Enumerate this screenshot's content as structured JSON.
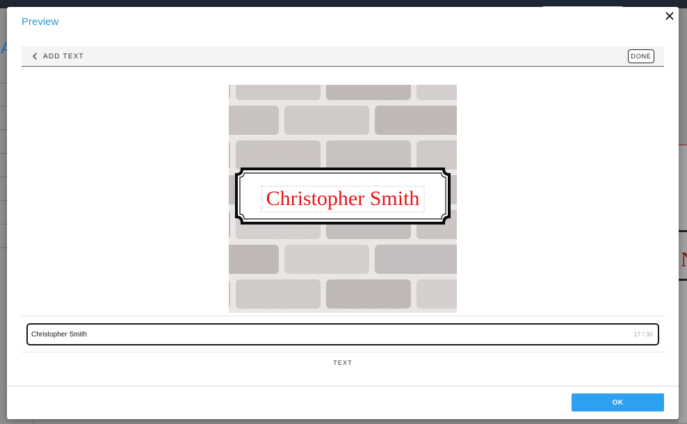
{
  "background": {
    "letter": "A",
    "right_letter": "N"
  },
  "modal": {
    "title": "Preview",
    "close_icon": "close-icon"
  },
  "subbar": {
    "back_label": "ADD TEXT",
    "back_icon": "chevron-left-icon",
    "done_label": "DONE"
  },
  "preview": {
    "sign_text": "Christopher Smith",
    "text_color": "#e8141b",
    "background": "brick-wall"
  },
  "text_input": {
    "value": "Christopher Smith",
    "char_count": "17 / 30"
  },
  "tab": {
    "label": "TEXT"
  },
  "footer": {
    "ok_label": "OK"
  },
  "colors": {
    "accent": "#2ea0f2",
    "title": "#2f97d4"
  }
}
